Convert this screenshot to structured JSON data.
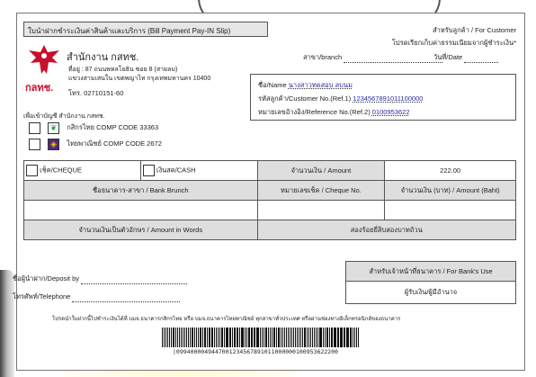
{
  "slip": {
    "title": "ใบนำฝากชำระเงินค่าสินค้าและบริการ (Bill Payment Pay-IN Slip)",
    "for_customer": "สำหรับลูกค้า / For Customer",
    "fee_note": "โปรดเรียกเก็บค่าธรรมเนียมจากผู้ชำระเงิน*",
    "branch_label": "สาขา/branch",
    "date_label": "วันที่/Date",
    "org": {
      "logo_text": "กลทช.",
      "name": "สำนักงาน กสทช.",
      "address_line1": "ที่อยู่ : 87 ถนนพหลโยธิน ซอย 8 (สายลม)",
      "address_line2": "แขวงสามเสนใน เขตพญาไท กรุงเทพมหานคร 10400",
      "phone": "โทร. 02710151-60",
      "account_title": "เพื่อเข้าบัญชี สำนักงาน กสทช."
    },
    "banks": [
      {
        "name": "กสิกรไทย COMP CODE 33363",
        "icon": "kbank-icon",
        "color": "#1aa34a"
      },
      {
        "name": "ไทยพาณิชย์ COMP CODE 2672",
        "icon": "scb-icon",
        "color": "#4e2a84"
      }
    ],
    "customer": {
      "name_label": "ชื่อ/Name",
      "name_value": "นางสาวทดสอบ ลบนม",
      "ref1_label": "รหัสลูกค้า/Customer No.(Ref.1)",
      "ref1_value": "1234567891011100000",
      "ref2_label": "หมายเลขอ้างอิง/Reference No.(Ref.2)",
      "ref2_value": "0100953622"
    },
    "payment": {
      "cheque_label": "เช็ค/CHEQUE",
      "cash_label": "เงินสด/CASH",
      "amount_label": "จำนวนเงิน / Amount",
      "amount_value": "222.00",
      "bank_branch_header": "ชื่อธนาคาร-สาขา / Bank Brunch",
      "cheque_no_header": "หมายเลขเช็ค / Cheque No.",
      "amount_baht_header": "จำนวนเงิน (บาท) / Amount (Baht)",
      "amount_words_label": "จำนวนเงินเป็นตัวอักษร / Amount in Words",
      "amount_words_value": "สองร้อยยี่สิบสองบาทถ้วน"
    },
    "deposit_by_label": "ชื่อผู้นำฝาก/Deposit by",
    "telephone_label": "โทรศัพท์/Telephone",
    "bank_use": {
      "title": "สำหรับเจ้าหน้าที่ธนาคาร / For Bank's Use",
      "receiver": "ผู้รับเงิน/ผู้มีอำนาจ"
    },
    "footer_note": "โปรดนำใบฝากนี้ไปชำระเงินได้ที่ บมจ.ธนาคารกสิกรไทย หรือ บมจ.ธนาคารไทยพาณิชย์ ทุกสาขาทั่วประเทศ หรือผ่านช่องทางอิเล็กทรอนิกส์ของธนาคาร",
    "barcode_text": "|0994000049447001234567891011000000100953622200"
  }
}
